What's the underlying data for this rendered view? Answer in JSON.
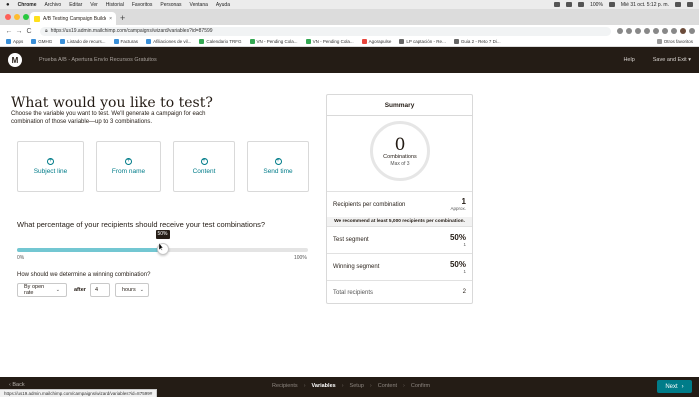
{
  "macbar": {
    "apple": "",
    "app": "Chrome",
    "menus": [
      "Archivo",
      "Editar",
      "Ver",
      "Historial",
      "Favoritos",
      "Personas",
      "Ventana",
      "Ayuda"
    ],
    "battery": "100%",
    "clock": "Mié 31 oct.  5:12 p. m."
  },
  "browser": {
    "tab_title": "A/B Testing Campaign Builder |",
    "tab_close": "×",
    "new_tab": "+",
    "url": "https://us19.admin.mailchimp.com/campaigns/wizard/variables?id=87599",
    "nav_back": "←",
    "nav_forward": "→",
    "nav_reload": "C",
    "bookmarks": [
      "Apps",
      "GMHG",
      "Listado de recurs...",
      "Facturas",
      "Afiliaciones de vil...",
      "Calendario TRFG",
      "VN - Pending Cola...",
      "VN - Pending Cola...",
      "Agorapulse",
      "LP captación - Re...",
      "Guia 2 - Reto 7 Di..."
    ],
    "other_bookmarks": "Otros favoritos",
    "status_url": "https://us19.admin.mailchimp.com/campaigns/wizard/variables?id=87599#"
  },
  "header": {
    "logo": "M",
    "title": "Prueba A/B - Apertura Envío Recursos Gratuitos",
    "help": "Help",
    "save_exit": "Save and Exit ▾"
  },
  "main": {
    "heading": "What would you like to test?",
    "subtitle": "Choose the variable you want to test. We'll generate a campaign for each combination of those variable—up to 3 combinations.",
    "variables": [
      {
        "label": "Subject line",
        "plus": "+"
      },
      {
        "label": "From name",
        "plus": "+"
      },
      {
        "label": "Content",
        "plus": "+"
      },
      {
        "label": "Send time",
        "plus": "+"
      }
    ],
    "percent_question": "What percentage of your recipients should receive your test combinations?",
    "slider": {
      "value": 50,
      "tooltip": "50%",
      "min_label": "0%",
      "max_label": "100%"
    },
    "winner_question": "How should we determine a winning combination?",
    "metric_select": "By open rate",
    "after_label": "after",
    "duration_value": "4",
    "unit_select": "hours",
    "chevron": "⌄"
  },
  "summary": {
    "title": "Summary",
    "combinations": "0",
    "combinations_label": "Combinations",
    "max_label": "Max of 3",
    "rows": [
      {
        "label": "Recipients per combination",
        "value": "1",
        "sub": "Approx."
      },
      {
        "label": "Test segment",
        "value": "50%",
        "sub": "1"
      },
      {
        "label": "Winning segment",
        "value": "50%",
        "sub": "1"
      },
      {
        "label": "Total recipients",
        "value": "2",
        "sub": ""
      }
    ],
    "recommend": "We recommend at least 5,000 recipients per combination."
  },
  "footer": {
    "back": "‹  Back",
    "steps": [
      "Recipients",
      "Variables",
      "Setup",
      "Content",
      "Confirm"
    ],
    "step_sep": "›",
    "current_step": 1,
    "next": "Next",
    "next_arrow": "›"
  },
  "colors": {
    "brand_dark": "#241c15",
    "accent_teal": "#007c89",
    "slider_fill": "#73c7d2",
    "mailchimp_yellow": "#ffe01b"
  }
}
